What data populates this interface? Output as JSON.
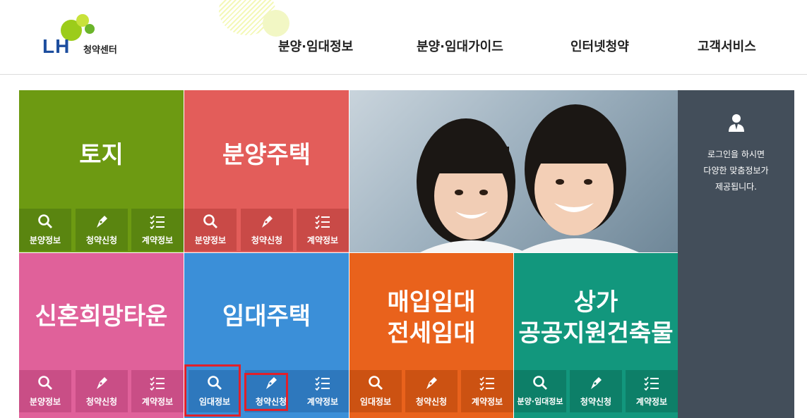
{
  "header": {
    "logo_text": "LH",
    "logo_sub": "청약센터",
    "nav": [
      "분양·임대정보",
      "분양·임대가이드",
      "인터넷청약",
      "고객서비스"
    ]
  },
  "tiles": {
    "land": {
      "title": "토지",
      "color": "#6d9a12",
      "subs": [
        "분양정보",
        "청약신청",
        "계약정보"
      ]
    },
    "sale_housing": {
      "title": "분양주택",
      "color": "#e35d5a",
      "subs": [
        "분양정보",
        "청약신청",
        "계약정보"
      ]
    },
    "newlywed": {
      "title": "신혼희망타운",
      "color": "#e0619a",
      "subs": [
        "분양정보",
        "청약신청",
        "계약정보"
      ]
    },
    "rental_housing": {
      "title": "임대주택",
      "color": "#3b8fd8",
      "subs": [
        "임대정보",
        "청약신청",
        "계약정보"
      ]
    },
    "purchase_rental": {
      "title_line1": "매입임대",
      "title_line2": "전세임대",
      "color": "#e9621c",
      "subs": [
        "임대정보",
        "청약신청",
        "계약정보"
      ]
    },
    "commercial": {
      "title_line1": "상가",
      "title_line2": "공공지원건축물",
      "color": "#12977d",
      "subs": [
        "분양·임대정보",
        "청약신청",
        "계약정보"
      ]
    }
  },
  "login_panel": {
    "line1": "로그인을 하시면",
    "line2": "다양한 맞춤정보가",
    "line3": "제공됩니다."
  },
  "icons": [
    "search-icon",
    "pen-icon",
    "checklist-icon",
    "user-icon"
  ]
}
